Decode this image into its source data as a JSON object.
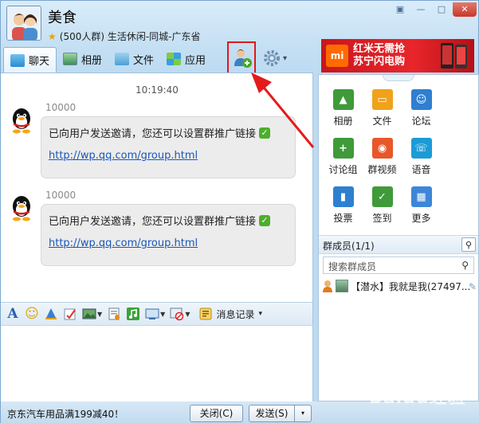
{
  "window": {
    "group_name": "美食",
    "group_desc": "(500人群) 生活休闲-同城-广东省",
    "controls": {
      "minimize": "—",
      "restore": "□",
      "close": "✕"
    },
    "menu_glyph": "▣"
  },
  "toolbar": {
    "tabs": [
      {
        "label": "聊天",
        "active": true
      },
      {
        "label": "相册"
      },
      {
        "label": "文件"
      },
      {
        "label": "应用"
      }
    ],
    "settings_arrow": "▾"
  },
  "ad": {
    "logo": "mi",
    "line1": "红米无需抢",
    "line2": "苏宁闪电购"
  },
  "chat": {
    "time": "10:19:40",
    "messages": [
      {
        "sender": "10000",
        "text": "已向用户发送邀请，您还可以设置群推广链接",
        "link": "http://wp.qq.com/group.html"
      },
      {
        "sender": "10000",
        "text": "已向用户发送邀请，您还可以设置群推广链接",
        "link": "http://wp.qq.com/group.html"
      }
    ]
  },
  "input_toolbar": {
    "history_label": "消息记录",
    "history_arrow": "▾",
    "font_glyph": "A",
    "emoji_glyph": "☺"
  },
  "bottom": {
    "ad_text": "京东汽车用品满199减40！",
    "close_label": "关闭(C)",
    "send_label": "发送(S)",
    "send_arrow": "▾"
  },
  "apps": [
    {
      "label": "相册",
      "color": "#3f9a3a"
    },
    {
      "label": "文件",
      "color": "#f0a21b"
    },
    {
      "label": "论坛",
      "color": "#2f7fd1"
    },
    {
      "label": "讨论组",
      "color": "#3f9a3a"
    },
    {
      "label": "群视频",
      "color": "#e8572a"
    },
    {
      "label": "语音",
      "color": "#1c9bd6"
    },
    {
      "label": "投票",
      "color": "#2f7fd1"
    },
    {
      "label": "签到",
      "color": "#3f9a3a"
    },
    {
      "label": "更多",
      "color": "#3d86d8"
    }
  ],
  "members": {
    "title": "群成员(1/1)",
    "search_placeholder": "搜索群成员",
    "list": [
      {
        "name": "【潜水】我就是我(27497..."
      }
    ]
  },
  "watermark": "Baidu经验"
}
